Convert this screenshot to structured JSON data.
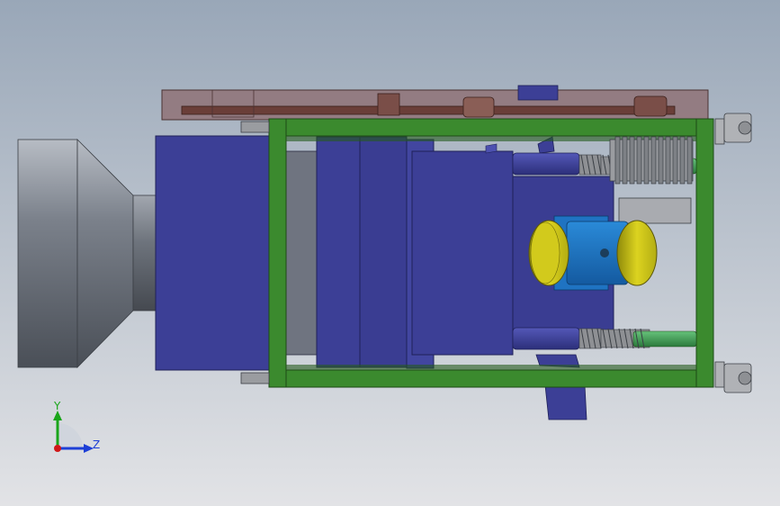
{
  "viewport": {
    "background_top": "#99a7b8",
    "background_bottom": "#e2e3e6"
  },
  "colors": {
    "frame_green": "#3b8a2e",
    "frame_green_dark": "#245a1c",
    "body_blue": "#3c3f96",
    "body_blue_light": "#4d51b0",
    "body_blue_dark": "#2a2c6e",
    "cone_gray": "#7d838d",
    "belt_guard": "#8c6a6c",
    "belt_dark": "#6a3e38",
    "spring_gray": "#8e9094",
    "rod_green": "#3f9a55",
    "motor_yellow": "#c9c215",
    "motor_blue": "#1f73c2",
    "gear_gray": "#9a9ca0",
    "caster_gray": "#b0b2b6"
  },
  "components": {
    "hopper_cone": "hopper-cone",
    "main_housing": "main-housing",
    "support_frame": "support-frame",
    "belt_guard": "belt-guard",
    "vibration_motor": "vibration-motor",
    "spring_dampers": "spring-dampers",
    "casters": "caster-wheels",
    "gear_drive": "gear-drive"
  },
  "triad": {
    "y_label": "Y",
    "z_label": "Z",
    "y_color": "#1aa51a",
    "z_color": "#1d3fd6",
    "origin_color": "#d01818"
  }
}
